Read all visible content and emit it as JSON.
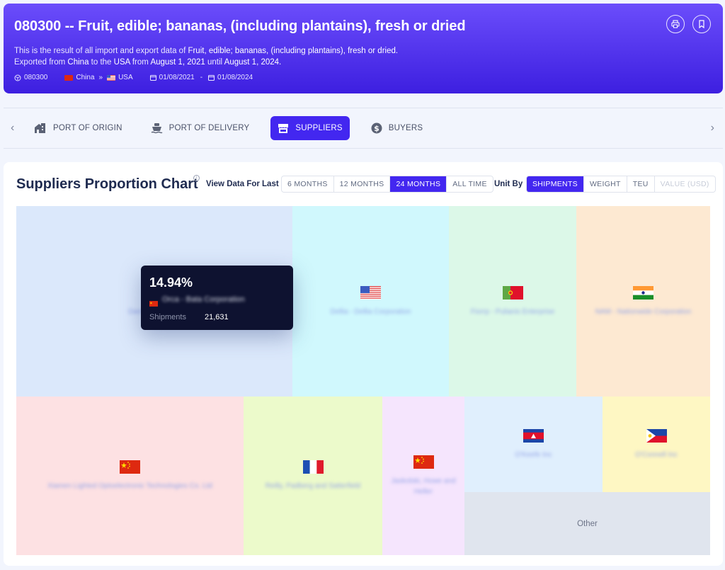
{
  "header": {
    "title": "080300 -- Fruit, edible; bananas, (including plantains), fresh or dried",
    "desc_line1_pre": "This is the result of all import and export data of ",
    "desc_line1_product": "Fruit, edible; bananas, (including plantains), fresh or dried.",
    "desc_line2_a": "Exported from ",
    "desc_line2_origin": "China",
    "desc_line2_b": " to the ",
    "desc_line2_dest": "USA",
    "desc_line2_c": " from ",
    "desc_line2_start": "August 1, 2021",
    "desc_line2_d": " until ",
    "desc_line2_end": "August 1, 2024.",
    "meta": {
      "hs_code": "080300",
      "origin": "China",
      "separator": "»",
      "destination": "USA",
      "date_start": "01/08/2021",
      "date_dash": "-",
      "date_end": "01/08/2024"
    },
    "actions": [
      "print-icon",
      "bookmark-icon"
    ]
  },
  "tabs": [
    {
      "label": "PORT OF ORIGIN",
      "icon": "port-origin-icon",
      "active": false
    },
    {
      "label": "PORT OF DELIVERY",
      "icon": "ship-icon",
      "active": false
    },
    {
      "label": "SUPPLIERS",
      "icon": "store-icon",
      "active": true
    },
    {
      "label": "BUYERS",
      "icon": "dollar-icon",
      "active": false
    }
  ],
  "card": {
    "title": "Suppliers Proportion Chart",
    "info": "i",
    "view_label": "View Data For Last",
    "periods": [
      "6 MONTHS",
      "12 MONTHS",
      "24 MONTHS",
      "ALL TIME"
    ],
    "period_selected": "24 MONTHS",
    "unit_label": "Unit By",
    "units": [
      "SHIPMENTS",
      "WEIGHT",
      "TEU",
      "VALUE (USD)"
    ],
    "unit_selected": "SHIPMENTS",
    "unit_disabled": "VALUE (USD)"
  },
  "tooltip": {
    "percent": "14.94%",
    "country": "China",
    "name": "Orca - Bata Corporation",
    "metric": "Shipments",
    "value": "21,631"
  },
  "chart_data": {
    "type": "treemap",
    "title": "Suppliers Proportion Chart",
    "metric": "Shipments",
    "items": [
      {
        "name": "Damian Group",
        "country": "China",
        "color": "#dbe8fb"
      },
      {
        "name": "Dellia - Dellia Corporation",
        "country": "USA",
        "color": "#d0f8fd"
      },
      {
        "name": "Fiorrp - Pulianis Enterprise",
        "country": "Portugal",
        "color": "#dcf8e8"
      },
      {
        "name": "NAM - Nationwide Corporation",
        "country": "India",
        "color": "#fde9d2"
      },
      {
        "name": "Xiamen Lighted Optoelectronic Technologies Co. Ltd",
        "country": "China",
        "color": "#fde1e3"
      },
      {
        "name": "Reilly, Padberg and Satterfield",
        "country": "France",
        "color": "#ecfacb"
      },
      {
        "name": "Jaskolski, Howe and Heller",
        "country": "China",
        "color": "#f5e5fd"
      },
      {
        "name": "O'Keefe Inc",
        "country": "Cambodia",
        "color": "#e0effd"
      },
      {
        "name": "O'Connell Inc",
        "country": "Philippines",
        "color": "#fef7c3"
      },
      {
        "name": "Other",
        "country": "",
        "color": "#e0e5ee"
      }
    ],
    "highlighted": {
      "percent": 14.94,
      "shipments": 21631
    }
  }
}
